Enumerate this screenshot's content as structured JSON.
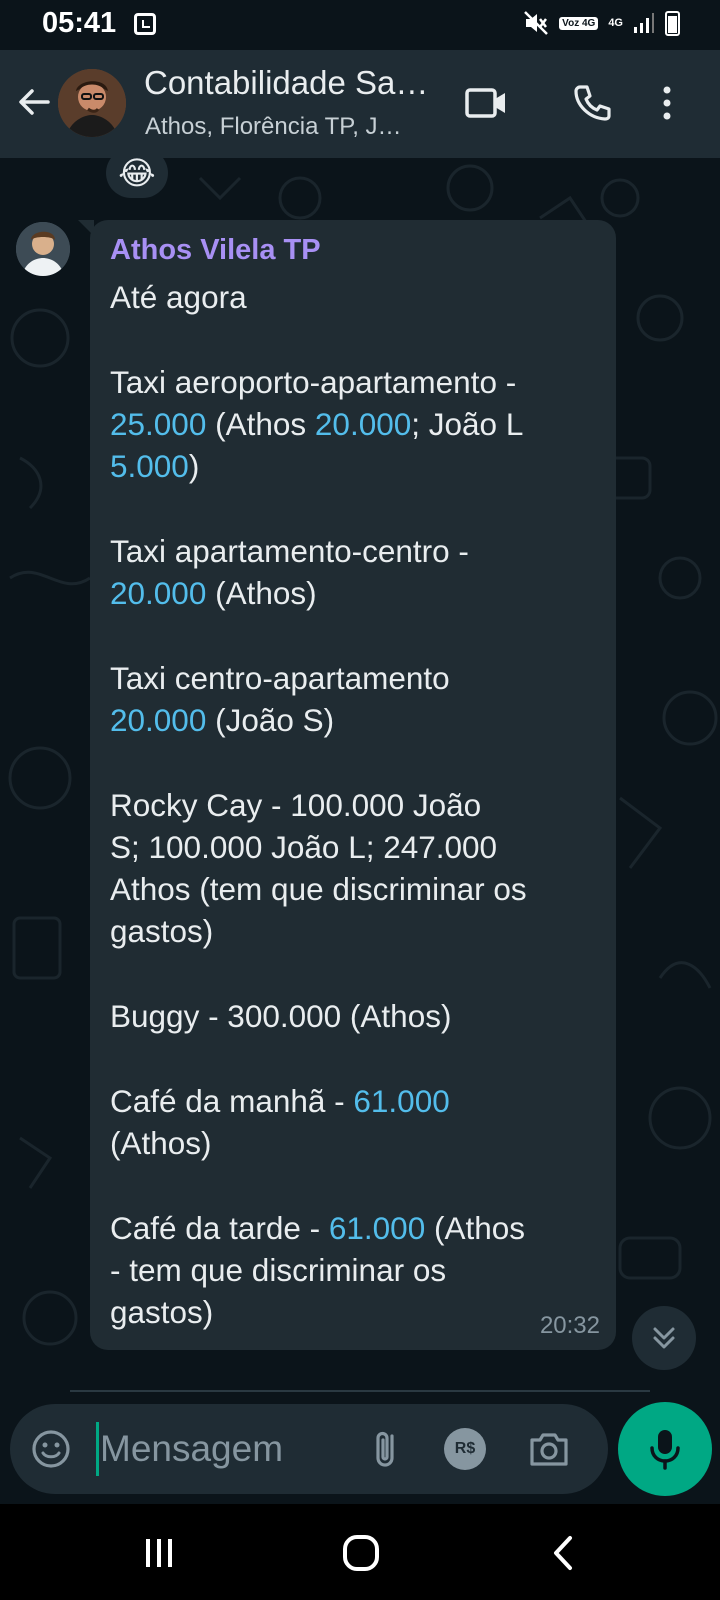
{
  "status_bar": {
    "time": "05:41",
    "volte": "Voz 4G",
    "network": "4G"
  },
  "header": {
    "title": "Contabilidade Sa…",
    "subtitle": "Athos, Florência TP, J…"
  },
  "reaction": {
    "emoji": "😂"
  },
  "message": {
    "sender": "Athos Vilela TP",
    "time": "20:32",
    "lines": [
      [
        {
          "t": "Até agora"
        }
      ],
      [],
      [
        {
          "t": "Taxi aeroporto-apartamento -"
        }
      ],
      [
        {
          "t": "25.000",
          "n": true
        },
        {
          "t": " (Athos "
        },
        {
          "t": "20.000",
          "n": true
        },
        {
          "t": "; João L"
        }
      ],
      [
        {
          "t": "5.000",
          "n": true
        },
        {
          "t": ")"
        }
      ],
      [],
      [
        {
          "t": "Taxi apartamento-centro -"
        }
      ],
      [
        {
          "t": "20.000",
          "n": true
        },
        {
          "t": " (Athos)"
        }
      ],
      [],
      [
        {
          "t": "Taxi centro-apartamento"
        }
      ],
      [
        {
          "t": "20.000",
          "n": true
        },
        {
          "t": " (João S)"
        }
      ],
      [],
      [
        {
          "t": "Rocky Cay - 100.000 João"
        }
      ],
      [
        {
          "t": "S; 100.000 João L; 247.000"
        }
      ],
      [
        {
          "t": "Athos (tem que discriminar os"
        }
      ],
      [
        {
          "t": "gastos)"
        }
      ],
      [],
      [
        {
          "t": "Buggy - 300.000 (Athos)"
        }
      ],
      [],
      [
        {
          "t": "Café da manhã - "
        },
        {
          "t": "61.000",
          "n": true
        }
      ],
      [
        {
          "t": "(Athos)"
        }
      ],
      [],
      [
        {
          "t": "Café da tarde - "
        },
        {
          "t": "61.000",
          "n": true
        },
        {
          "t": " (Athos"
        }
      ],
      [
        {
          "t": "- tem que discriminar os"
        }
      ],
      [
        {
          "t": "gastos)"
        }
      ]
    ]
  },
  "input": {
    "placeholder": "Mensagem",
    "pay_label": "R$"
  },
  "colors": {
    "accent": "#00a884",
    "sender": "#a890f4",
    "link_number": "#53bdeb",
    "bubble": "#202c33",
    "header": "#1f2c34"
  },
  "icons": {
    "back": "arrow-left-icon",
    "video": "video-camera-icon",
    "call": "phone-icon",
    "menu": "more-vertical-icon",
    "emoji": "smiley-icon",
    "attach": "paperclip-icon",
    "camera": "camera-icon",
    "mic": "microphone-icon",
    "scroll": "double-chevron-down-icon"
  }
}
